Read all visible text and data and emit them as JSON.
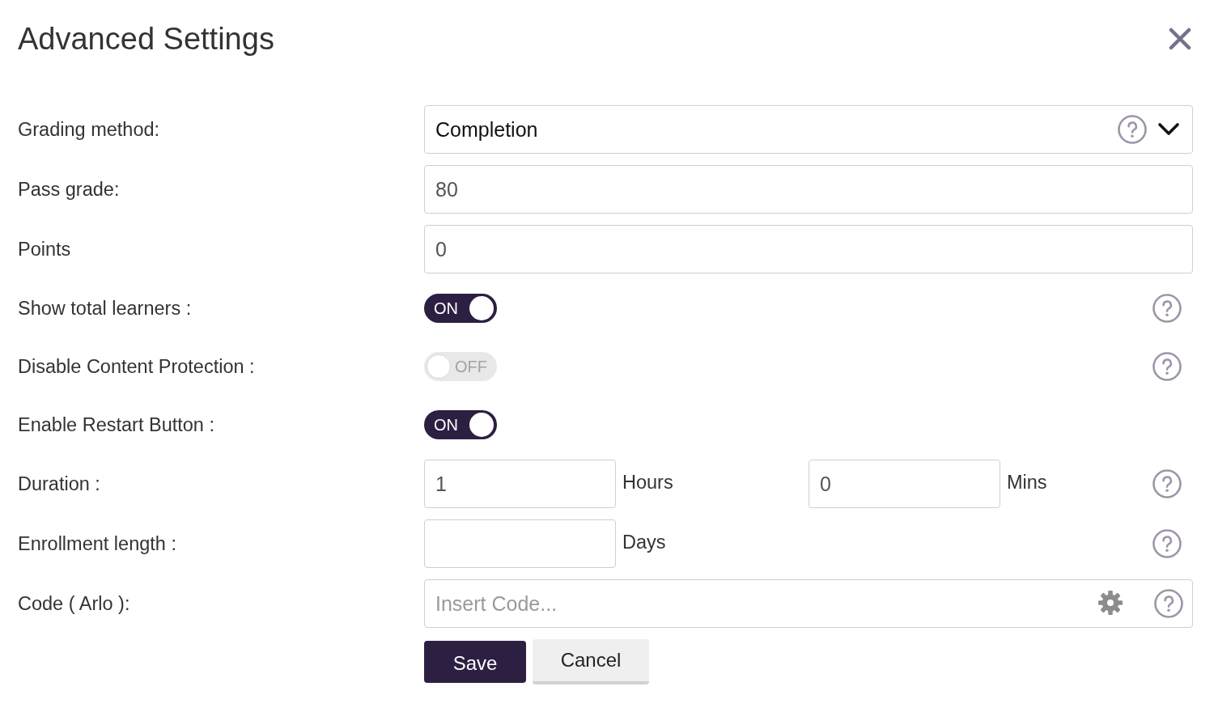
{
  "dialog": {
    "title": "Advanced Settings"
  },
  "rows": [
    {
      "kind": "select",
      "label": "Grading method:",
      "value": "Completion",
      "help": true
    },
    {
      "kind": "text",
      "label": "Pass grade:",
      "value": "80",
      "help": false
    },
    {
      "kind": "text",
      "label": "Points",
      "value": "0",
      "help": false
    },
    {
      "kind": "toggle",
      "label": "Show total learners :",
      "on": true,
      "toggle_text": "ON",
      "help": true
    },
    {
      "kind": "toggle",
      "label": "Disable Content Protection :",
      "on": false,
      "toggle_text": "OFF",
      "help": true
    },
    {
      "kind": "toggle",
      "label": "Enable Restart Button :",
      "on": true,
      "toggle_text": "ON",
      "help": false
    },
    {
      "kind": "units",
      "label": "Duration :",
      "fields": [
        {
          "value": "1",
          "unit": "Hours"
        },
        {
          "value": "0",
          "unit": "Mins"
        }
      ],
      "help": true
    },
    {
      "kind": "units",
      "label": "Enrollment length :",
      "fields": [
        {
          "unit": "Days"
        }
      ],
      "help": true
    },
    {
      "kind": "code",
      "label": "Code ( Arlo ):",
      "placeholder": "Insert Code...",
      "help": true
    }
  ],
  "buttons": [
    {
      "kind": "primary",
      "label": "Save"
    },
    {
      "kind": "secondary",
      "label": "Cancel"
    }
  ]
}
